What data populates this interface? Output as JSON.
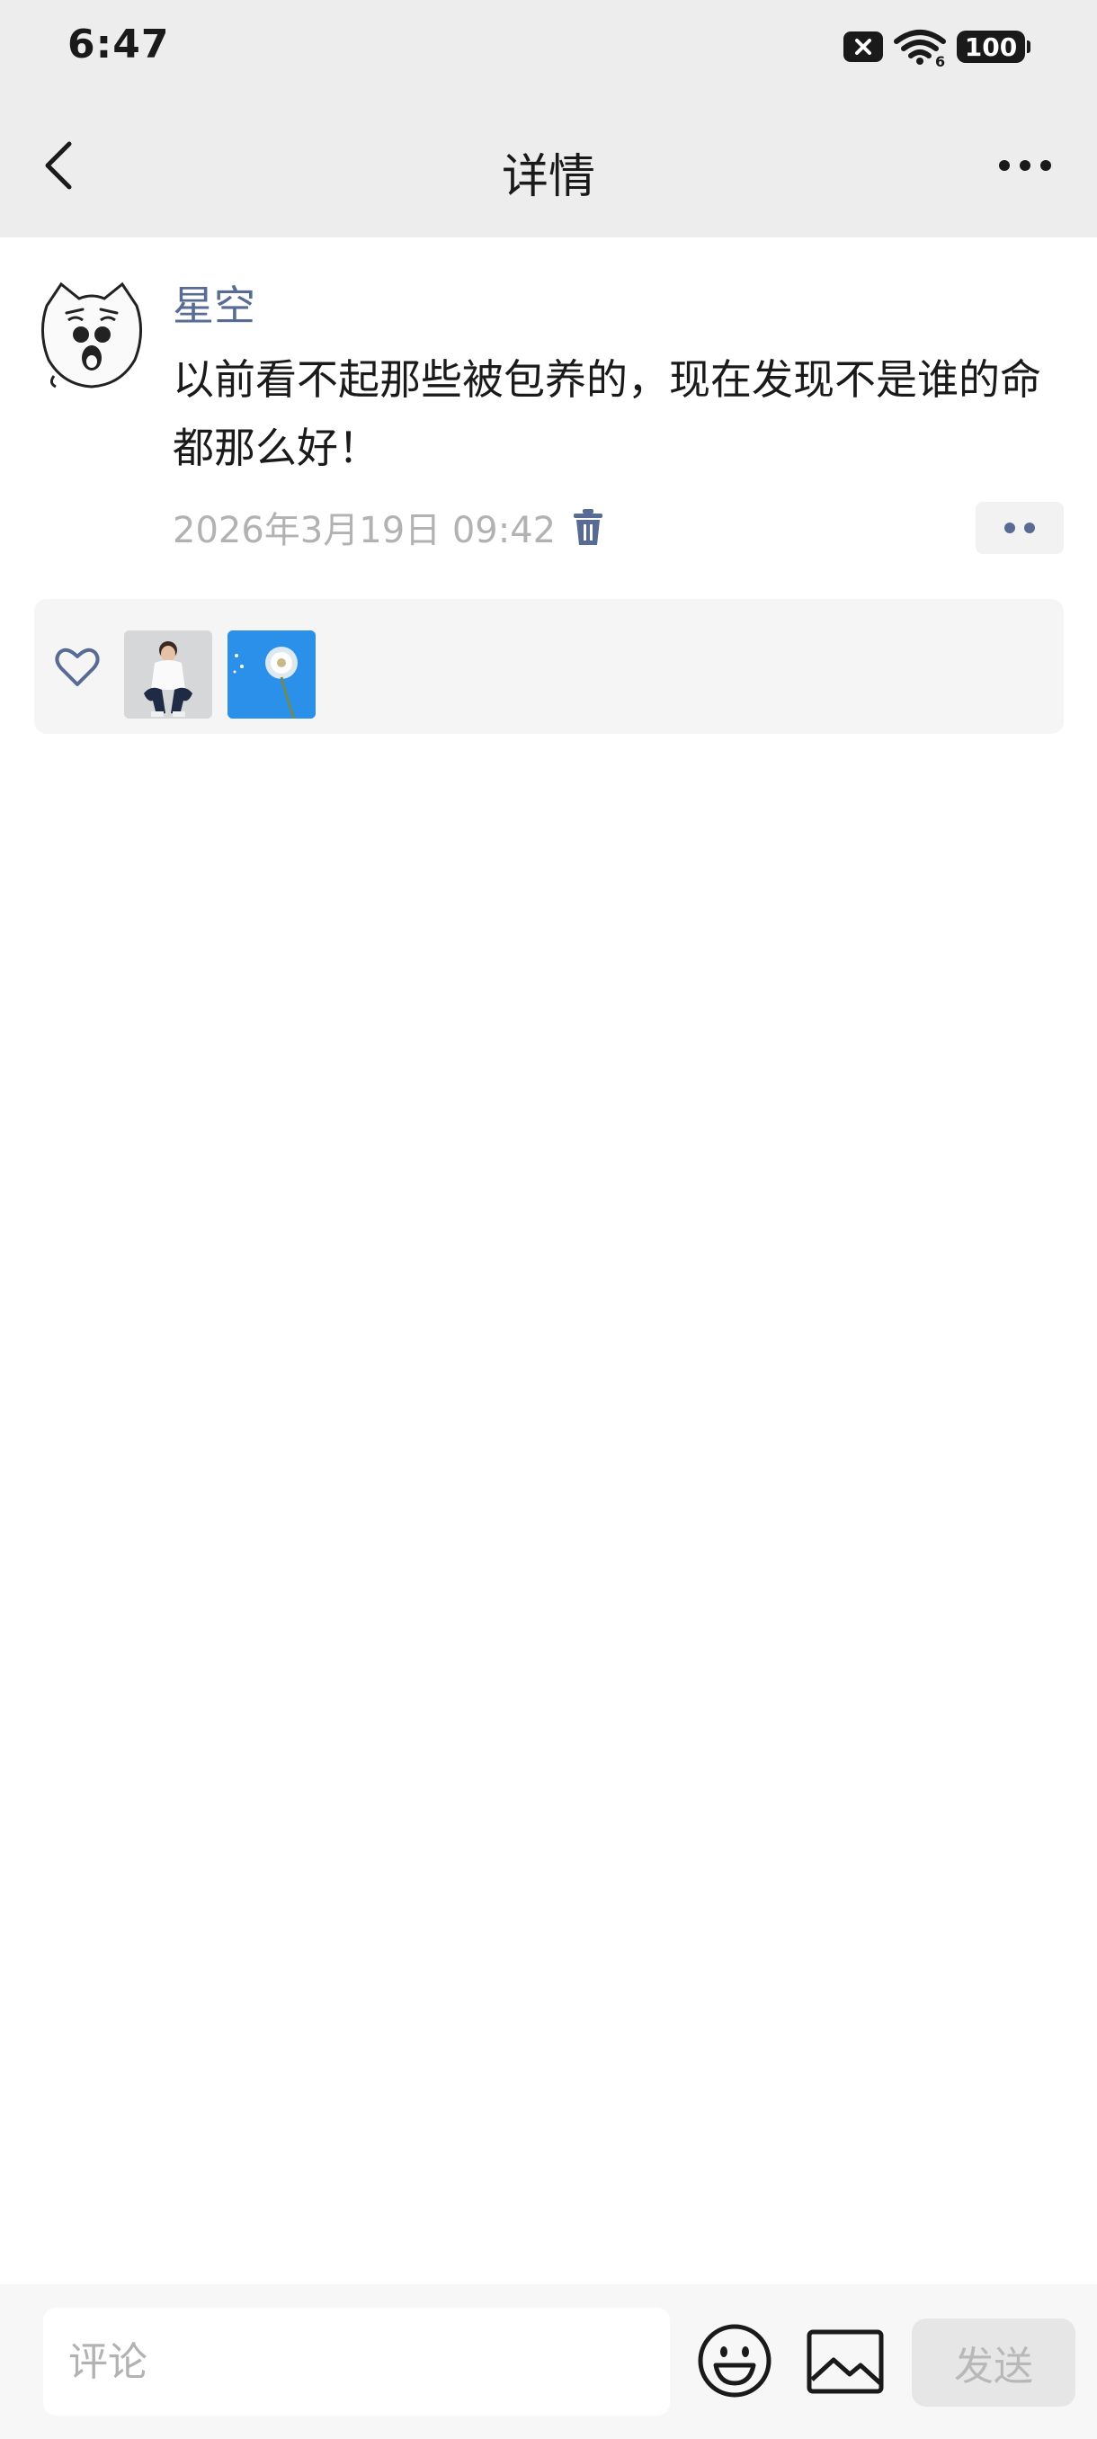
{
  "status_bar": {
    "time": "6:47",
    "battery": "100",
    "wifi_badge": "6"
  },
  "header": {
    "title": "详情"
  },
  "post": {
    "author": "星空",
    "text": "以前看不起那些被包养的，现在发现不是谁的命都那么好！",
    "timestamp": "2026年3月19日 09:42"
  },
  "comment_bar": {
    "placeholder": "评论",
    "send_label": "发送"
  },
  "colors": {
    "link": "#576b95",
    "header_bg": "#ededed",
    "meta_text": "#b2b2b2"
  },
  "icons": [
    "back-icon",
    "more-icon",
    "trash-icon",
    "heart-icon",
    "emoji-icon",
    "image-icon",
    "wifi-icon",
    "sim-icon"
  ]
}
